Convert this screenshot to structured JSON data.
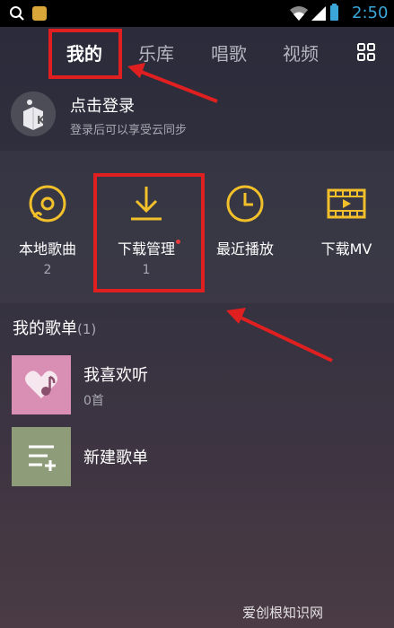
{
  "status_bar": {
    "time": "2:50"
  },
  "tabs": [
    {
      "label": "我的",
      "active": true
    },
    {
      "label": "乐库",
      "active": false
    },
    {
      "label": "唱歌",
      "active": false
    },
    {
      "label": "视频",
      "active": false
    }
  ],
  "login": {
    "title": "点击登录",
    "subtitle": "登录后可以享受云同步"
  },
  "quick_actions": [
    {
      "label": "本地歌曲",
      "count": "2",
      "icon": "local-music-icon"
    },
    {
      "label": "下载管理",
      "count": "1",
      "icon": "download-icon"
    },
    {
      "label": "最近播放",
      "count": "",
      "icon": "clock-icon"
    },
    {
      "label": "下载MV",
      "count": "",
      "icon": "mv-film-icon"
    }
  ],
  "playlists": {
    "header": "我的歌单",
    "count": "(1)",
    "items": [
      {
        "name": "我喜欢听",
        "sub": "0首",
        "icon": "heart-music-icon",
        "color": "#d98fb3"
      },
      {
        "name": "新建歌单",
        "sub": "",
        "icon": "add-list-icon",
        "color": "#8f9c79"
      }
    ]
  },
  "colors": {
    "accent": "#f2c02a",
    "annotation": "#e02020",
    "status_time": "#3aa7d8"
  },
  "watermark": "爱创根知识网"
}
